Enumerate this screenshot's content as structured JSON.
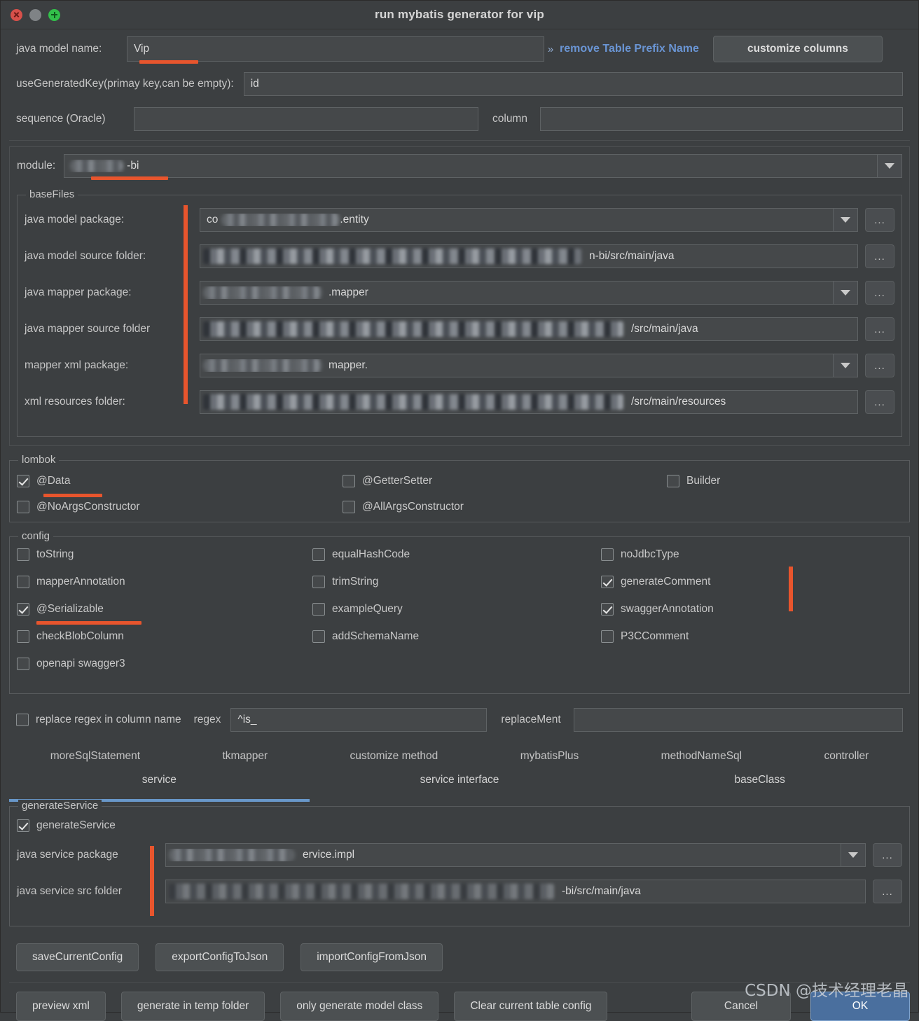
{
  "window": {
    "title": "run mybatis generator for vip",
    "controls": [
      "close-button",
      "minimize-button",
      "zoom-button"
    ]
  },
  "top": {
    "java_model_name_label": "java model name:",
    "java_model_name_value": "Vip",
    "remove_prefix_link": "remove Table Prefix Name",
    "remove_prefix_chevron": "»",
    "customize_columns_button": "customize columns",
    "use_generated_key_label": "useGeneratedKey(primay key,can be empty):",
    "use_generated_key_value": "id",
    "sequence_label": "sequence (Oracle)",
    "sequence_value": "",
    "column_label": "column",
    "column_value": ""
  },
  "module": {
    "label": "module:",
    "value": "-bi"
  },
  "base_files": {
    "title": "baseFiles",
    "rows": [
      {
        "label": "java model package:",
        "value": ".entity",
        "prefix": "co",
        "type": "combo",
        "browse": "..."
      },
      {
        "label": "java model source folder:",
        "value": "n-bi/src/main/java",
        "prefix": "",
        "type": "text",
        "browse": "..."
      },
      {
        "label": "java mapper package:",
        "value": ".mapper",
        "prefix": "",
        "type": "combo",
        "browse": "..."
      },
      {
        "label": "java mapper source folder",
        "value": "/src/main/java",
        "prefix": "",
        "type": "text",
        "browse": "..."
      },
      {
        "label": "mapper xml package:",
        "value": "mapper.",
        "prefix": "",
        "type": "combo",
        "browse": "..."
      },
      {
        "label": "xml resources folder:",
        "value": "/src/main/resources",
        "prefix": "",
        "type": "text",
        "browse": "..."
      }
    ]
  },
  "lombok": {
    "title": "lombok",
    "items": [
      {
        "label": "@Data",
        "checked": true,
        "underline": true
      },
      {
        "label": "@GetterSetter",
        "checked": false,
        "underline": false
      },
      {
        "label": "Builder",
        "checked": false,
        "underline": false
      },
      {
        "label": "@NoArgsConstructor",
        "checked": false,
        "underline": false
      },
      {
        "label": "@AllArgsConstructor",
        "checked": false,
        "underline": false
      }
    ]
  },
  "config": {
    "title": "config",
    "col1": [
      {
        "label": "toString",
        "checked": false,
        "underline": false
      },
      {
        "label": "mapperAnnotation",
        "checked": false,
        "underline": false
      },
      {
        "label": "@Serializable",
        "checked": true,
        "underline": true
      },
      {
        "label": "checkBlobColumn",
        "checked": false,
        "underline": false
      },
      {
        "label": "openapi swagger3",
        "checked": false,
        "underline": false
      }
    ],
    "col2": [
      {
        "label": "equalHashCode",
        "checked": false,
        "underline": false
      },
      {
        "label": "trimString",
        "checked": false,
        "underline": false
      },
      {
        "label": "exampleQuery",
        "checked": false,
        "underline": false
      },
      {
        "label": "addSchemaName",
        "checked": false,
        "underline": false
      }
    ],
    "col3": [
      {
        "label": "noJdbcType",
        "checked": false,
        "underline": false
      },
      {
        "label": "generateComment",
        "checked": true,
        "underline": false
      },
      {
        "label": "swaggerAnnotation",
        "checked": true,
        "underline": false
      },
      {
        "label": "P3CComment",
        "checked": false,
        "underline": false
      }
    ]
  },
  "regex_row": {
    "checkbox_label": "replace regex in column name",
    "checked": false,
    "regex_label": "regex",
    "regex_value": "^is_",
    "replacement_label": "replaceMent",
    "replacement_value": ""
  },
  "tabs": {
    "row1": [
      {
        "label": "moreSqlStatement",
        "active": false
      },
      {
        "label": "tkmapper",
        "active": false
      },
      {
        "label": "customize method",
        "active": false
      },
      {
        "label": "mybatisPlus",
        "active": false
      },
      {
        "label": "methodNameSql",
        "active": false
      },
      {
        "label": "controller",
        "active": false
      }
    ],
    "row2": [
      {
        "label": "service",
        "active": true
      },
      {
        "label": "service interface",
        "active": false
      },
      {
        "label": "baseClass",
        "active": false
      }
    ],
    "active_color": "#6897c9"
  },
  "generate_service": {
    "title": "generateService",
    "checkbox_label": "generateService",
    "checked": true,
    "rows": [
      {
        "label": "java service package",
        "value": "ervice.impl",
        "type": "combo",
        "browse": "..."
      },
      {
        "label": "java service src folder",
        "value": "-bi/src/main/java",
        "type": "text",
        "browse": "..."
      }
    ]
  },
  "config_buttons": [
    "saveCurrentConfig",
    "exportConfigToJson",
    "importConfigFromJson"
  ],
  "action_buttons": [
    {
      "label": "preview xml",
      "primary": false
    },
    {
      "label": "generate in temp folder",
      "primary": false
    },
    {
      "label": "only generate model class",
      "primary": false
    },
    {
      "label": "Clear current table config",
      "primary": false
    },
    {
      "label": "Cancel",
      "primary": false
    },
    {
      "label": "OK",
      "primary": true
    }
  ],
  "watermark": "CSDN @技术经理老晶",
  "colors": {
    "background": "#3c3f41",
    "field": "#45484a",
    "accent_blue": "#6897c9",
    "link_blue": "#6a95d4",
    "annotation_red": "#e8552d",
    "primary_button": "#4a6f9e"
  }
}
